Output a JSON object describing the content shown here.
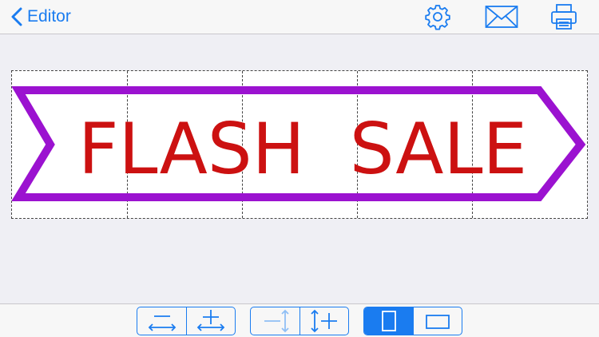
{
  "theme": {
    "accent": "#1a7cf0",
    "banner_text_color": "#cc1111",
    "banner_frame_color": "#9b12d0"
  },
  "nav": {
    "back_label": "Editor",
    "icons": [
      "chevron-left-icon",
      "gear-icon",
      "mail-icon",
      "printer-icon"
    ]
  },
  "banner": {
    "text": "FLASH  SALE",
    "tiles_across": 5
  },
  "toolbar": {
    "groups": [
      {
        "name": "width-controls",
        "buttons": [
          "decrease-width",
          "increase-width"
        ]
      },
      {
        "name": "height-controls",
        "buttons": [
          "decrease-height",
          "increase-height"
        ]
      },
      {
        "name": "orientation-controls",
        "buttons": [
          "portrait",
          "landscape"
        ],
        "selected": "portrait"
      }
    ]
  }
}
